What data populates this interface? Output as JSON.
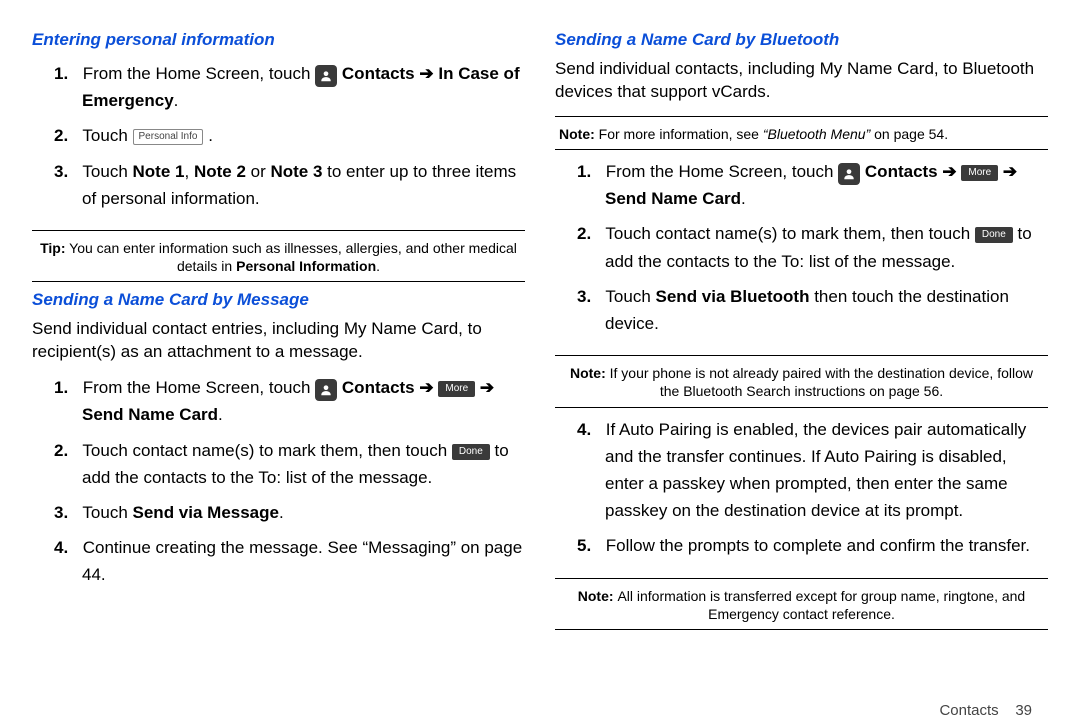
{
  "left": {
    "h1": "Entering personal information",
    "s1_pre": "From the Home Screen, touch ",
    "contacts": "Contacts",
    "arrow": "➔",
    "ice": "In Case of Emergency",
    "period": ".",
    "s2_pre": "Touch ",
    "personal_info_btn": "Personal Info",
    "s3": "Touch ",
    "note1": "Note 1",
    "comma": ", ",
    "note2": "Note 2",
    "or": " or ",
    "note3": "Note 3",
    "s3_tail": " to enter up to three items of personal information.",
    "tip_label": "Tip:",
    "tip_text": " You can enter information such as illnesses, allergies, and other medical details in ",
    "tip_bold": "Personal Information",
    "h2": "Sending a Name Card by Message",
    "intro2": "Send individual contact entries, including My Name Card, to recipient(s) as an attachment to a message.",
    "m1_pre": "From the Home Screen, touch ",
    "more_btn": "More",
    "send_name_card": "Send Name Card",
    "m2_pre": "Touch contact name(s) to mark them, then touch ",
    "done_btn": "Done",
    "m2_tail": " to add the contacts to the To: list of the message.",
    "m3_pre": "Touch ",
    "m3_bold": "Send via Message",
    "m4": "Continue creating the message. See “Messaging” on page 44."
  },
  "right": {
    "h1": "Sending a Name Card by Bluetooth",
    "intro": "Send individual contacts, including My Name Card, to Bluetooth devices that support vCards.",
    "note1_label": "Note:",
    "note1_text": " For more information, see ",
    "note1_em": "“Bluetooth Menu”",
    "note1_tail": " on page 54.",
    "b1_pre": "From the Home Screen, touch ",
    "b2_pre": "Touch contact name(s) to mark them, then touch ",
    "b2_tail": " to add the contacts to the To: list of the message.",
    "b3_pre": "Touch ",
    "b3_bold": "Send via Bluetooth",
    "b3_tail": " then touch the destination device.",
    "note2_label": "Note:",
    "note2_text": " If your phone is not already paired with the destination device, follow the Bluetooth Search instructions on page 56.",
    "b4": "If Auto Pairing is enabled, the devices pair automatically and the transfer continues. If Auto Pairing is disabled, enter a passkey when prompted, then enter the same passkey on the destination device at its prompt.",
    "b5": "Follow the prompts to complete and confirm the transfer.",
    "note3_label": "Note: ",
    "note3_text": " All information is transferred except for group name, ringtone, and Emergency contact reference."
  },
  "footer": {
    "section": "Contacts",
    "page": "39"
  }
}
